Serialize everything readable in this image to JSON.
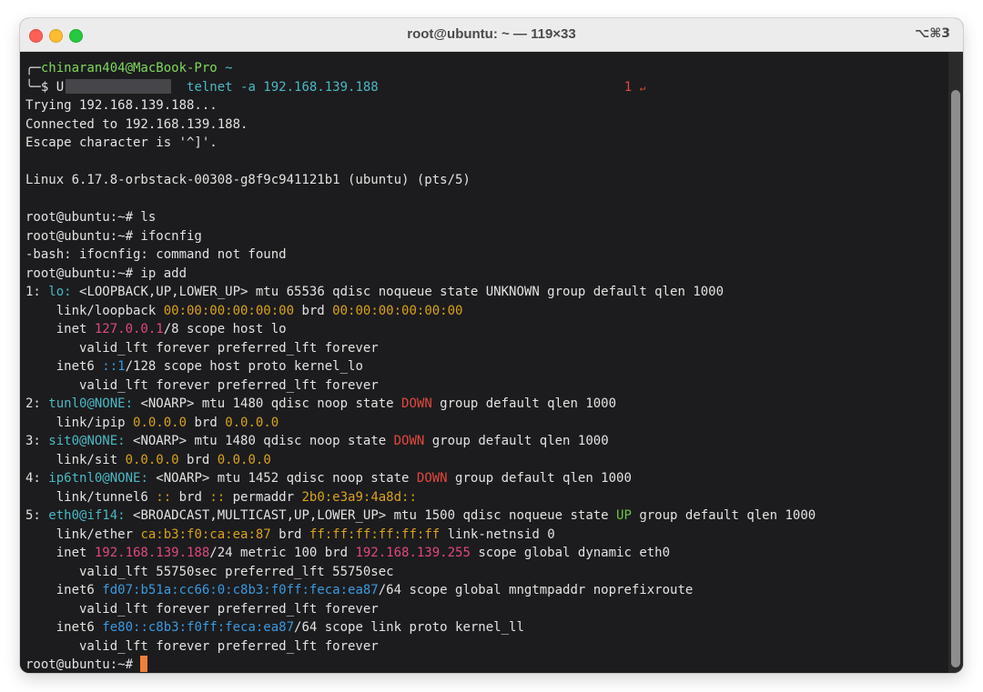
{
  "window": {
    "title": "root@ubuntu: ~ — 119×33",
    "shortcut": "⌥⌘3"
  },
  "colors": {
    "default": "#e2e2e2",
    "prompt_green": "#7fd85c",
    "cyan": "#4bb8c4",
    "magenta": "#e0487d",
    "yellow": "#d9a21c",
    "red": "#e0483e",
    "green": "#6cc246",
    "blue": "#3a9ae0",
    "cursor": "#f07f3c"
  },
  "terminal": {
    "host_prompt_prefix": "╭─",
    "host_prompt_user": "chinaran404@MacBook-Pro",
    "host_prompt_dir": "~",
    "cmd_prompt": "╰─$ ",
    "cmd_first_char": "U",
    "cmd_text": "telnet -a 192.168.139.188",
    "annotation_number": "1",
    "annotation_arrow": "↵",
    "lines": [
      [
        {
          "t": "Trying 192.168.139.188..."
        }
      ],
      [
        {
          "t": "Connected to 192.168.139.188."
        }
      ],
      [
        {
          "t": "Escape character is '^]'."
        }
      ],
      [
        {
          "t": ""
        }
      ],
      [
        {
          "t": "Linux 6.17.8-orbstack-00308-g8f9c941121b1 (ubuntu) (pts/5)"
        }
      ],
      [
        {
          "t": ""
        }
      ],
      [
        {
          "t": "root@ubuntu:~# ls"
        }
      ],
      [
        {
          "t": "root@ubuntu:~# ifocnfig"
        }
      ],
      [
        {
          "t": "-bash: ifocnfig: command not found"
        }
      ],
      [
        {
          "t": "root@ubuntu:~# ip add"
        }
      ],
      [
        {
          "t": "1: "
        },
        {
          "t": "lo:",
          "c": "cyan"
        },
        {
          "t": " <LOOPBACK,UP,LOWER_UP> mtu 65536 qdisc noqueue state UNKNOWN group default qlen 1000"
        }
      ],
      [
        {
          "t": "    link/loopback "
        },
        {
          "t": "00:00:00:00:00:00",
          "c": "yellow"
        },
        {
          "t": " brd "
        },
        {
          "t": "00:00:00:00:00:00",
          "c": "yellow"
        }
      ],
      [
        {
          "t": "    inet "
        },
        {
          "t": "127.0.0.1",
          "c": "magenta"
        },
        {
          "t": "/8 scope host lo"
        }
      ],
      [
        {
          "t": "       valid_lft forever preferred_lft forever"
        }
      ],
      [
        {
          "t": "    inet6 "
        },
        {
          "t": "::1",
          "c": "blue"
        },
        {
          "t": "/128 scope host proto kernel_lo"
        }
      ],
      [
        {
          "t": "       valid_lft forever preferred_lft forever"
        }
      ],
      [
        {
          "t": "2: "
        },
        {
          "t": "tunl0@NONE:",
          "c": "cyan"
        },
        {
          "t": " <NOARP> mtu 1480 qdisc noop state "
        },
        {
          "t": "DOWN",
          "c": "red"
        },
        {
          "t": " group default qlen 1000"
        }
      ],
      [
        {
          "t": "    link/ipip "
        },
        {
          "t": "0.0.0.0",
          "c": "yellow"
        },
        {
          "t": " brd "
        },
        {
          "t": "0.0.0.0",
          "c": "yellow"
        }
      ],
      [
        {
          "t": "3: "
        },
        {
          "t": "sit0@NONE:",
          "c": "cyan"
        },
        {
          "t": " <NOARP> mtu 1480 qdisc noop state "
        },
        {
          "t": "DOWN",
          "c": "red"
        },
        {
          "t": " group default qlen 1000"
        }
      ],
      [
        {
          "t": "    link/sit "
        },
        {
          "t": "0.0.0.0",
          "c": "yellow"
        },
        {
          "t": " brd "
        },
        {
          "t": "0.0.0.0",
          "c": "yellow"
        }
      ],
      [
        {
          "t": "4: "
        },
        {
          "t": "ip6tnl0@NONE:",
          "c": "cyan"
        },
        {
          "t": " <NOARP> mtu 1452 qdisc noop state "
        },
        {
          "t": "DOWN",
          "c": "red"
        },
        {
          "t": " group default qlen 1000"
        }
      ],
      [
        {
          "t": "    link/tunnel6 "
        },
        {
          "t": "::",
          "c": "yellow"
        },
        {
          "t": " brd "
        },
        {
          "t": "::",
          "c": "yellow"
        },
        {
          "t": " permaddr "
        },
        {
          "t": "2b0:e3a9:4a8d::",
          "c": "yellow"
        }
      ],
      [
        {
          "t": "5: "
        },
        {
          "t": "eth0@if14:",
          "c": "cyan"
        },
        {
          "t": " <BROADCAST,MULTICAST,UP,LOWER_UP> mtu 1500 qdisc noqueue state "
        },
        {
          "t": "UP",
          "c": "green"
        },
        {
          "t": " group default qlen 1000"
        }
      ],
      [
        {
          "t": "    link/ether "
        },
        {
          "t": "ca:b3:f0:ca:ea:87",
          "c": "yellow"
        },
        {
          "t": " brd "
        },
        {
          "t": "ff:ff:ff:ff:ff:ff",
          "c": "yellow"
        },
        {
          "t": " link-netnsid 0"
        }
      ],
      [
        {
          "t": "    inet "
        },
        {
          "t": "192.168.139.188",
          "c": "magenta"
        },
        {
          "t": "/24 metric 100 brd "
        },
        {
          "t": "192.168.139.255",
          "c": "magenta"
        },
        {
          "t": " scope global dynamic eth0"
        }
      ],
      [
        {
          "t": "       valid_lft 55750sec preferred_lft 55750sec"
        }
      ],
      [
        {
          "t": "    inet6 "
        },
        {
          "t": "fd07:b51a:cc66:0:c8b3:f0ff:feca:ea87",
          "c": "blue"
        },
        {
          "t": "/64 scope global mngtmpaddr noprefixroute"
        }
      ],
      [
        {
          "t": "       valid_lft forever preferred_lft forever"
        }
      ],
      [
        {
          "t": "    inet6 "
        },
        {
          "t": "fe80::c8b3:f0ff:feca:ea87",
          "c": "blue"
        },
        {
          "t": "/64 scope link proto kernel_ll"
        }
      ],
      [
        {
          "t": "       valid_lft forever preferred_lft forever"
        }
      ]
    ],
    "final_prompt": "root@ubuntu:~# "
  }
}
